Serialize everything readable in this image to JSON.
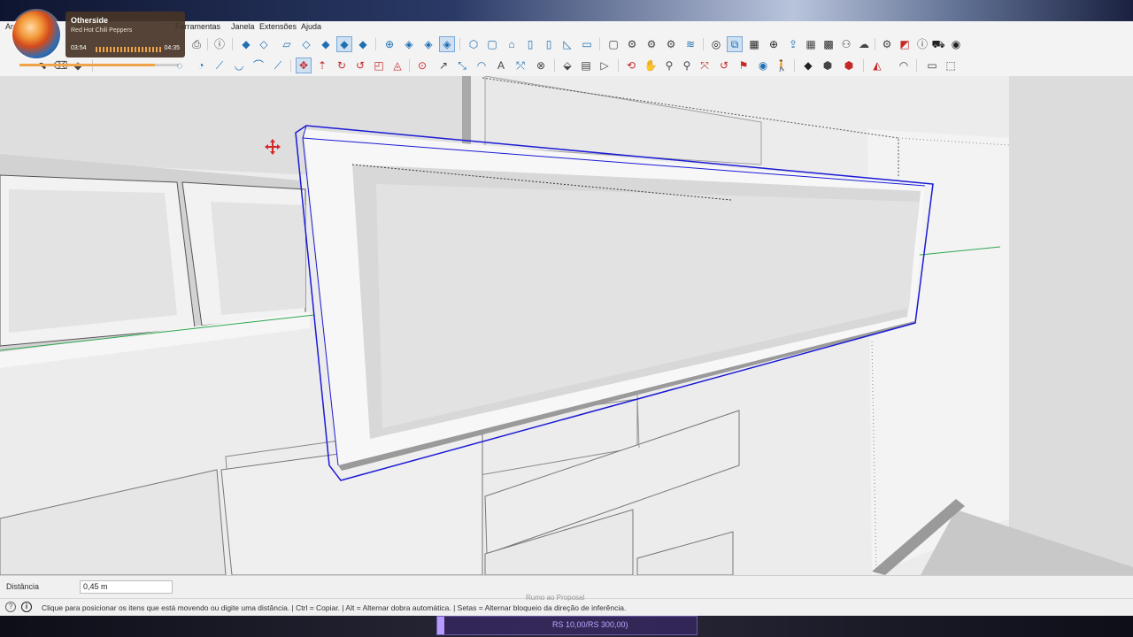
{
  "menu": {
    "items": [
      "Arq",
      "Ferramentas",
      "Janela",
      "Extensões",
      "Ajuda"
    ]
  },
  "music": {
    "title": "Otherside",
    "artist": "Red Hot Chili Peppers",
    "elapsed": "03:54",
    "duration": "04:35",
    "progress": 0.85
  },
  "toolbar1": {
    "icons": [
      "print-icon",
      "model-info-icon",
      "iso-view-icon",
      "top-view-icon",
      "front-view-icon",
      "right-view-icon",
      "back-view-icon",
      "left-view-icon",
      "bottom-view-icon",
      "xray-icon",
      "back-edges-icon",
      "wireframe-icon",
      "hidden-line-icon",
      "shaded-icon",
      "shaded-texture-icon",
      "monochrome-icon",
      "house-icon",
      "warehouse-icon",
      "extension-warehouse-icon",
      "cloud-icon",
      "settings-icon",
      "layout-icon",
      "info-icon",
      "cart-icon",
      "account-icon"
    ]
  },
  "toolbar2": {
    "icons": [
      "select-icon",
      "eraser-icon",
      "paint-icon",
      "line-icon",
      "arc-icon",
      "rectangle-icon",
      "circle-icon",
      "polygon-icon",
      "push-pull-icon",
      "move-icon",
      "rotate-icon",
      "scale-icon",
      "offset-icon",
      "follow-me-icon",
      "tape-icon",
      "protractor-icon",
      "dimension-icon",
      "text-icon",
      "axes-icon",
      "section-plane-icon",
      "orbit-icon",
      "pan-icon",
      "zoom-icon",
      "zoom-extents-icon",
      "walk-icon",
      "look-around-icon",
      "position-camera-icon",
      "solid-tools-icon",
      "sandbox-icon",
      "styles-icon",
      "scenes-icon"
    ]
  },
  "status": {
    "measure_label": "Distância",
    "measure_value": "0,45 m",
    "hint": "Clique para posicionar os itens que está movendo ou digite uma distância. | Ctrl = Copiar. | Alt = Alternar dobra automática. | Setas = Alternar bloqueio da direção de inferência.",
    "help_icon": "question-icon",
    "info_icon": "info-icon"
  },
  "overlay": {
    "label": "Rumo ao Proposal",
    "sub": "RS 10,00/RS 300,00)"
  },
  "colors": {
    "selection": "#1a1ad6",
    "green_axis": "#2fa84f",
    "red_axis": "#d62828"
  }
}
